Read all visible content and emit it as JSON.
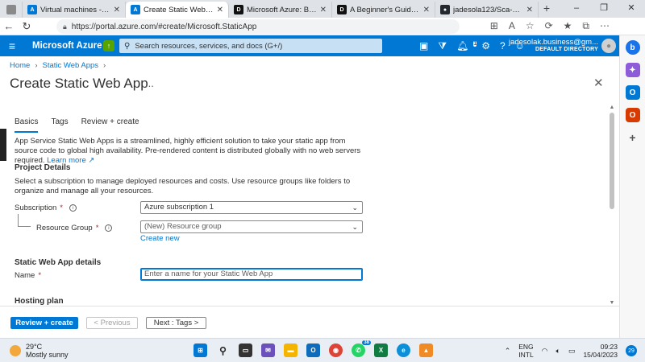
{
  "browser": {
    "tabs": [
      {
        "label": "",
        "icon": "tab-actions-icon"
      },
      {
        "label": "Virtual machines - Microsoft",
        "icon": "azure-icon"
      },
      {
        "label": "Create Static Web App - Microsoft",
        "icon": "azure-icon",
        "active": true
      },
      {
        "label": "Microsoft Azure: Building",
        "icon": "dev-icon"
      },
      {
        "label": "A Beginner's Guide to Amazon",
        "icon": "dev-icon"
      },
      {
        "label": "jadesola123/Sca-Azure-st...",
        "icon": "github-icon"
      }
    ],
    "url": "https://portal.azure.com/#create/Microsoft.StaticApp"
  },
  "azure": {
    "brand": "Microsoft Azure",
    "search_placeholder": "Search resources, services, and docs (G+/)",
    "notification_count": "1",
    "account_email": "jadesolak.business@gm...",
    "account_directory": "DEFAULT DIRECTORY"
  },
  "page": {
    "breadcrumb": [
      "Home",
      "Static Web Apps"
    ],
    "title": "Create Static Web App",
    "more": "...",
    "tabs": [
      "Basics",
      "Tags",
      "Review + create"
    ],
    "description": "App Service Static Web Apps is a streamlined, highly efficient solution to take your static app from source code to global high availability. Pre-rendered content is distributed globally with no web servers required.",
    "learn_more": "Learn more",
    "project_details_title": "Project Details",
    "project_details_desc": "Select a subscription to manage deployed resources and costs. Use resource groups like folders to organize and manage all your resources.",
    "subscription_label": "Subscription",
    "subscription_value": "Azure subscription 1",
    "resource_group_label": "Resource Group",
    "resource_group_value": "(New) Resource group",
    "create_new": "Create new",
    "swa_details_title": "Static Web App details",
    "name_label": "Name",
    "name_placeholder": "Enter a name for your Static Web App",
    "hosting_plan_title": "Hosting plan"
  },
  "footer": {
    "review_create": "Review + create",
    "previous": "< Previous",
    "next": "Next : Tags >"
  },
  "taskbar": {
    "temperature": "29°C",
    "weather": "Mostly sunny",
    "lang_top": "ENG",
    "lang_bottom": "INTL",
    "time": "09:23",
    "date": "15/04/2023",
    "whatsapp_badge": "38",
    "notification_count": "29"
  }
}
